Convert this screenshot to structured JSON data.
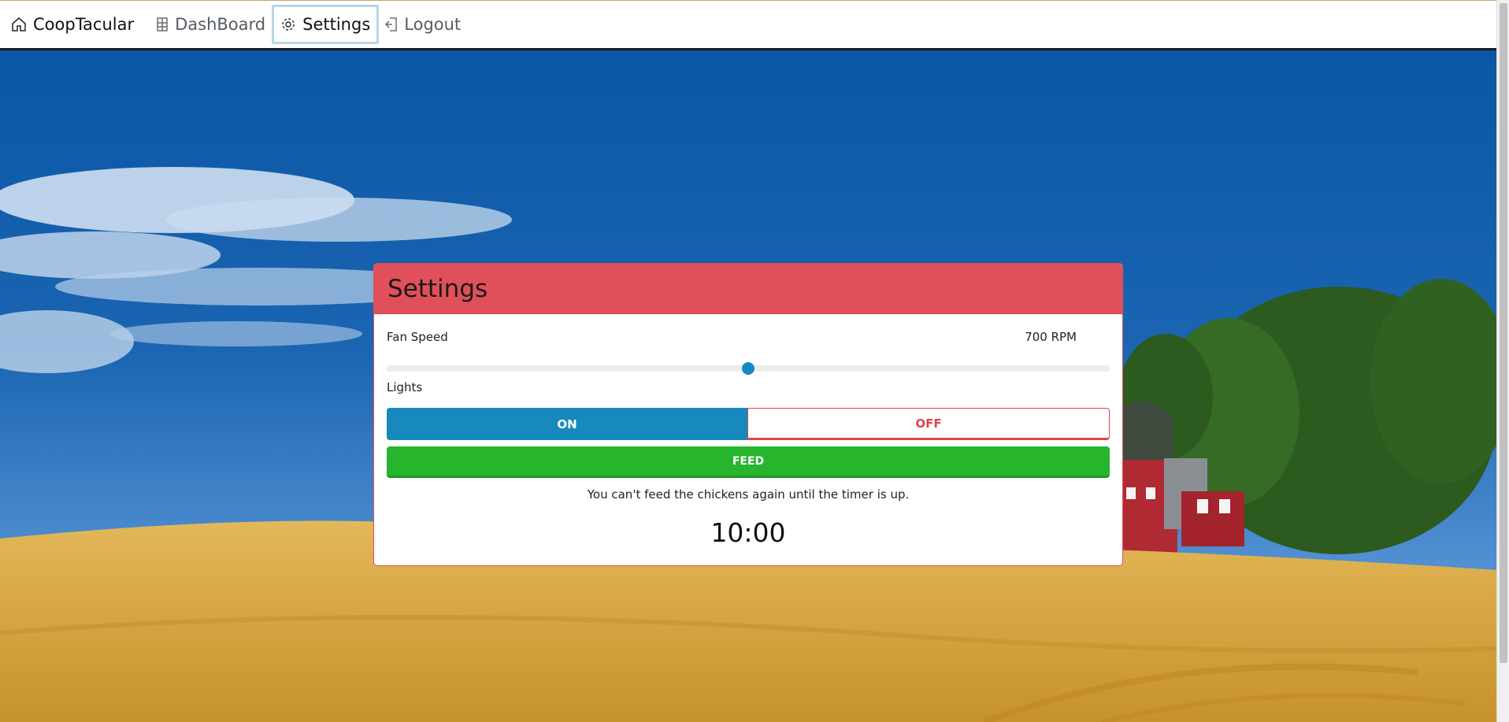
{
  "navbar": {
    "brand_label": "CoopTacular",
    "dashboard_label": "DashBoard",
    "settings_label": "Settings",
    "logout_label": "Logout",
    "icons": {
      "brand": "home-icon",
      "dashboard": "grid-icon",
      "settings": "gear-icon",
      "logout": "logout-icon"
    }
  },
  "settings": {
    "title": "Settings",
    "fan_speed_label": "Fan Speed",
    "fan_speed_value": "700 RPM",
    "fan_speed_fraction": 0.5,
    "lights_label": "Lights",
    "lights_on_label": "ON",
    "lights_off_label": "OFF",
    "lights_state": "on",
    "feed_label": "FEED",
    "notice": "You can't feed the chickens again until the timer is up.",
    "timer": "10:00"
  },
  "colors": {
    "header": "#e0505a",
    "toggle_on": "#1789bd",
    "toggle_off": "#e2434b",
    "feed": "#27b52e",
    "slider_thumb": "#168ac0"
  }
}
